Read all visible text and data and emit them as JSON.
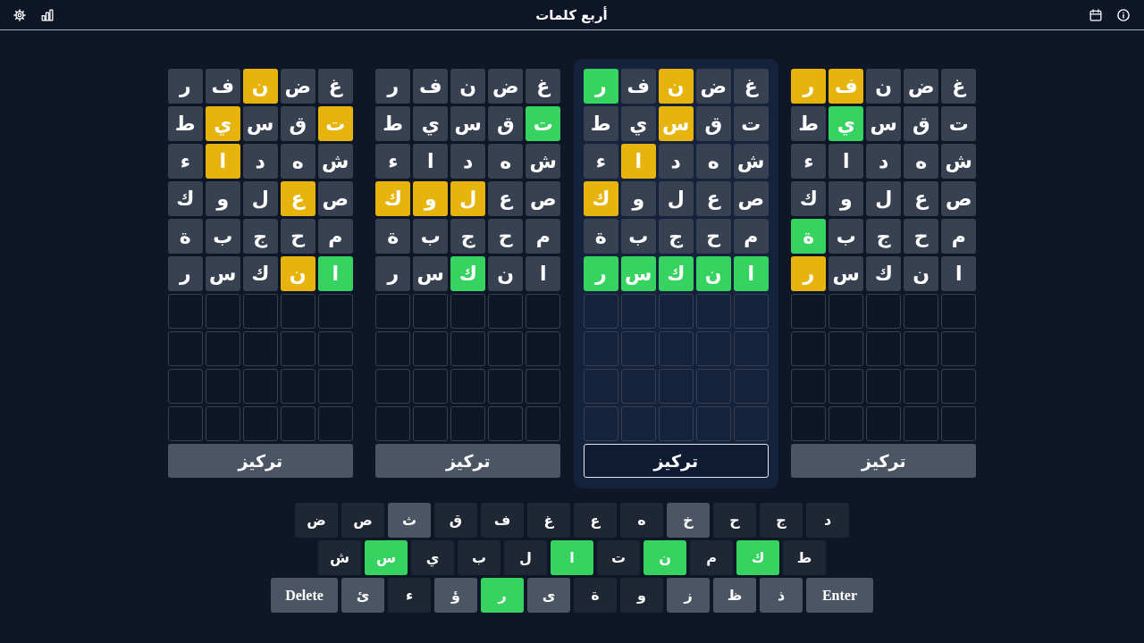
{
  "header": {
    "title": "أربع كلمات"
  },
  "boards": [
    {
      "focused": false,
      "button": "تركيز",
      "rows": [
        {
          "kind": "guess",
          "tiles": [
            {
              "letter": "غ",
              "color": "#374151"
            },
            {
              "letter": "ض",
              "color": "#374151"
            },
            {
              "letter": "ن",
              "color": "#374151"
            },
            {
              "letter": "ف",
              "color": "#e6b40c"
            },
            {
              "letter": "ر",
              "color": "#e6b40c"
            }
          ]
        },
        {
          "kind": "guess",
          "tiles": [
            {
              "letter": "ت",
              "color": "#374151"
            },
            {
              "letter": "ق",
              "color": "#374151"
            },
            {
              "letter": "س",
              "color": "#374151"
            },
            {
              "letter": "ي",
              "color": "#36d361"
            },
            {
              "letter": "ط",
              "color": "#374151"
            }
          ]
        },
        {
          "kind": "guess",
          "tiles": [
            {
              "letter": "ش",
              "color": "#374151"
            },
            {
              "letter": "ه",
              "color": "#374151"
            },
            {
              "letter": "د",
              "color": "#374151"
            },
            {
              "letter": "ا",
              "color": "#374151"
            },
            {
              "letter": "ء",
              "color": "#374151"
            }
          ]
        },
        {
          "kind": "guess",
          "tiles": [
            {
              "letter": "ص",
              "color": "#374151"
            },
            {
              "letter": "ع",
              "color": "#374151"
            },
            {
              "letter": "ل",
              "color": "#374151"
            },
            {
              "letter": "و",
              "color": "#374151"
            },
            {
              "letter": "ك",
              "color": "#374151"
            }
          ]
        },
        {
          "kind": "guess",
          "tiles": [
            {
              "letter": "م",
              "color": "#374151"
            },
            {
              "letter": "ح",
              "color": "#374151"
            },
            {
              "letter": "ج",
              "color": "#374151"
            },
            {
              "letter": "ب",
              "color": "#374151"
            },
            {
              "letter": "ة",
              "color": "#36d361"
            }
          ]
        },
        {
          "kind": "guess",
          "tiles": [
            {
              "letter": "ا",
              "color": "#374151"
            },
            {
              "letter": "ن",
              "color": "#374151"
            },
            {
              "letter": "ك",
              "color": "#374151"
            },
            {
              "letter": "س",
              "color": "#374151"
            },
            {
              "letter": "ر",
              "color": "#e6b40c"
            }
          ]
        },
        {
          "kind": "empty"
        },
        {
          "kind": "empty"
        },
        {
          "kind": "empty"
        },
        {
          "kind": "empty"
        }
      ]
    },
    {
      "focused": true,
      "button": "تركيز",
      "rows": [
        {
          "kind": "guess",
          "tiles": [
            {
              "letter": "غ",
              "color": "#374151"
            },
            {
              "letter": "ض",
              "color": "#374151"
            },
            {
              "letter": "ن",
              "color": "#e6b40c"
            },
            {
              "letter": "ف",
              "color": "#374151"
            },
            {
              "letter": "ر",
              "color": "#36d361"
            }
          ]
        },
        {
          "kind": "guess",
          "tiles": [
            {
              "letter": "ت",
              "color": "#374151"
            },
            {
              "letter": "ق",
              "color": "#374151"
            },
            {
              "letter": "س",
              "color": "#e6b40c"
            },
            {
              "letter": "ي",
              "color": "#374151"
            },
            {
              "letter": "ط",
              "color": "#374151"
            }
          ]
        },
        {
          "kind": "guess",
          "tiles": [
            {
              "letter": "ش",
              "color": "#374151"
            },
            {
              "letter": "ه",
              "color": "#374151"
            },
            {
              "letter": "د",
              "color": "#374151"
            },
            {
              "letter": "ا",
              "color": "#e6b40c"
            },
            {
              "letter": "ء",
              "color": "#374151"
            }
          ]
        },
        {
          "kind": "guess",
          "tiles": [
            {
              "letter": "ص",
              "color": "#374151"
            },
            {
              "letter": "ع",
              "color": "#374151"
            },
            {
              "letter": "ل",
              "color": "#374151"
            },
            {
              "letter": "و",
              "color": "#374151"
            },
            {
              "letter": "ك",
              "color": "#e6b40c"
            }
          ]
        },
        {
          "kind": "guess",
          "tiles": [
            {
              "letter": "م",
              "color": "#374151"
            },
            {
              "letter": "ح",
              "color": "#374151"
            },
            {
              "letter": "ج",
              "color": "#374151"
            },
            {
              "letter": "ب",
              "color": "#374151"
            },
            {
              "letter": "ة",
              "color": "#374151"
            }
          ]
        },
        {
          "kind": "guess",
          "tiles": [
            {
              "letter": "ا",
              "color": "#36d361"
            },
            {
              "letter": "ن",
              "color": "#36d361"
            },
            {
              "letter": "ك",
              "color": "#36d361"
            },
            {
              "letter": "س",
              "color": "#36d361"
            },
            {
              "letter": "ر",
              "color": "#36d361"
            }
          ]
        },
        {
          "kind": "empty"
        },
        {
          "kind": "empty"
        },
        {
          "kind": "empty"
        },
        {
          "kind": "empty"
        }
      ]
    },
    {
      "focused": false,
      "button": "تركيز",
      "rows": [
        {
          "kind": "guess",
          "tiles": [
            {
              "letter": "غ",
              "color": "#374151"
            },
            {
              "letter": "ض",
              "color": "#374151"
            },
            {
              "letter": "ن",
              "color": "#374151"
            },
            {
              "letter": "ف",
              "color": "#374151"
            },
            {
              "letter": "ر",
              "color": "#374151"
            }
          ]
        },
        {
          "kind": "guess",
          "tiles": [
            {
              "letter": "ت",
              "color": "#36d361"
            },
            {
              "letter": "ق",
              "color": "#374151"
            },
            {
              "letter": "س",
              "color": "#374151"
            },
            {
              "letter": "ي",
              "color": "#374151"
            },
            {
              "letter": "ط",
              "color": "#374151"
            }
          ]
        },
        {
          "kind": "guess",
          "tiles": [
            {
              "letter": "ش",
              "color": "#374151"
            },
            {
              "letter": "ه",
              "color": "#374151"
            },
            {
              "letter": "د",
              "color": "#374151"
            },
            {
              "letter": "ا",
              "color": "#374151"
            },
            {
              "letter": "ء",
              "color": "#374151"
            }
          ]
        },
        {
          "kind": "guess",
          "tiles": [
            {
              "letter": "ص",
              "color": "#374151"
            },
            {
              "letter": "ع",
              "color": "#374151"
            },
            {
              "letter": "ل",
              "color": "#e6b40c"
            },
            {
              "letter": "و",
              "color": "#e6b40c"
            },
            {
              "letter": "ك",
              "color": "#e6b40c"
            }
          ]
        },
        {
          "kind": "guess",
          "tiles": [
            {
              "letter": "م",
              "color": "#374151"
            },
            {
              "letter": "ح",
              "color": "#374151"
            },
            {
              "letter": "ج",
              "color": "#374151"
            },
            {
              "letter": "ب",
              "color": "#374151"
            },
            {
              "letter": "ة",
              "color": "#374151"
            }
          ]
        },
        {
          "kind": "guess",
          "tiles": [
            {
              "letter": "ا",
              "color": "#374151"
            },
            {
              "letter": "ن",
              "color": "#374151"
            },
            {
              "letter": "ك",
              "color": "#36d361"
            },
            {
              "letter": "س",
              "color": "#374151"
            },
            {
              "letter": "ر",
              "color": "#374151"
            }
          ]
        },
        {
          "kind": "empty"
        },
        {
          "kind": "empty"
        },
        {
          "kind": "empty"
        },
        {
          "kind": "empty"
        }
      ]
    },
    {
      "focused": false,
      "button": "تركيز",
      "rows": [
        {
          "kind": "guess",
          "tiles": [
            {
              "letter": "غ",
              "color": "#374151"
            },
            {
              "letter": "ض",
              "color": "#374151"
            },
            {
              "letter": "ن",
              "color": "#e6b40c"
            },
            {
              "letter": "ف",
              "color": "#374151"
            },
            {
              "letter": "ر",
              "color": "#374151"
            }
          ]
        },
        {
          "kind": "guess",
          "tiles": [
            {
              "letter": "ت",
              "color": "#e6b40c"
            },
            {
              "letter": "ق",
              "color": "#374151"
            },
            {
              "letter": "س",
              "color": "#374151"
            },
            {
              "letter": "ي",
              "color": "#e6b40c"
            },
            {
              "letter": "ط",
              "color": "#374151"
            }
          ]
        },
        {
          "kind": "guess",
          "tiles": [
            {
              "letter": "ش",
              "color": "#374151"
            },
            {
              "letter": "ه",
              "color": "#374151"
            },
            {
              "letter": "د",
              "color": "#374151"
            },
            {
              "letter": "ا",
              "color": "#e6b40c"
            },
            {
              "letter": "ء",
              "color": "#374151"
            }
          ]
        },
        {
          "kind": "guess",
          "tiles": [
            {
              "letter": "ص",
              "color": "#374151"
            },
            {
              "letter": "ع",
              "color": "#e6b40c"
            },
            {
              "letter": "ل",
              "color": "#374151"
            },
            {
              "letter": "و",
              "color": "#374151"
            },
            {
              "letter": "ك",
              "color": "#374151"
            }
          ]
        },
        {
          "kind": "guess",
          "tiles": [
            {
              "letter": "م",
              "color": "#374151"
            },
            {
              "letter": "ح",
              "color": "#374151"
            },
            {
              "letter": "ج",
              "color": "#374151"
            },
            {
              "letter": "ب",
              "color": "#374151"
            },
            {
              "letter": "ة",
              "color": "#374151"
            }
          ]
        },
        {
          "kind": "guess",
          "tiles": [
            {
              "letter": "ا",
              "color": "#36d361"
            },
            {
              "letter": "ن",
              "color": "#e6b40c"
            },
            {
              "letter": "ك",
              "color": "#374151"
            },
            {
              "letter": "س",
              "color": "#374151"
            },
            {
              "letter": "ر",
              "color": "#374151"
            }
          ]
        },
        {
          "kind": "empty"
        },
        {
          "kind": "empty"
        },
        {
          "kind": "empty"
        },
        {
          "kind": "empty"
        }
      ]
    }
  ],
  "keyboard": {
    "rows": [
      {
        "keys": [
          {
            "kind": "letter",
            "label": "د",
            "color": "#1f2735"
          },
          {
            "kind": "letter",
            "label": "ج",
            "color": "#1f2735"
          },
          {
            "kind": "letter",
            "label": "ح",
            "color": "#1f2735"
          },
          {
            "kind": "letter",
            "label": "خ",
            "color": "#4b5563"
          },
          {
            "kind": "letter",
            "label": "ه",
            "color": "#1f2735"
          },
          {
            "kind": "letter",
            "label": "ع",
            "color": "#1f2735"
          },
          {
            "kind": "letter",
            "label": "غ",
            "color": "#1f2735"
          },
          {
            "kind": "letter",
            "label": "ف",
            "color": "#1f2735"
          },
          {
            "kind": "letter",
            "label": "ق",
            "color": "#1f2735"
          },
          {
            "kind": "letter",
            "label": "ث",
            "color": "#4b5563"
          },
          {
            "kind": "letter",
            "label": "ص",
            "color": "#1f2735"
          },
          {
            "kind": "letter",
            "label": "ض",
            "color": "#1f2735"
          }
        ]
      },
      {
        "keys": [
          {
            "kind": "letter",
            "label": "ط",
            "color": "#1f2735"
          },
          {
            "kind": "letter",
            "label": "ك",
            "color": "#36d361"
          },
          {
            "kind": "letter",
            "label": "م",
            "color": "#1f2735"
          },
          {
            "kind": "letter",
            "label": "ن",
            "color": "#36d361"
          },
          {
            "kind": "letter",
            "label": "ت",
            "color": "#1f2735"
          },
          {
            "kind": "letter",
            "label": "ا",
            "color": "#36d361"
          },
          {
            "kind": "letter",
            "label": "ل",
            "color": "#1f2735"
          },
          {
            "kind": "letter",
            "label": "ب",
            "color": "#1f2735"
          },
          {
            "kind": "letter",
            "label": "ي",
            "color": "#1f2735"
          },
          {
            "kind": "letter",
            "label": "س",
            "color": "#36d361"
          },
          {
            "kind": "letter",
            "label": "ش",
            "color": "#1f2735"
          }
        ]
      },
      {
        "keys": [
          {
            "kind": "enter",
            "label": "Enter"
          },
          {
            "kind": "letter",
            "label": "ذ",
            "color": "#4b5563"
          },
          {
            "kind": "letter",
            "label": "ظ",
            "color": "#4b5563"
          },
          {
            "kind": "letter",
            "label": "ز",
            "color": "#4b5563"
          },
          {
            "kind": "letter",
            "label": "و",
            "color": "#1f2735"
          },
          {
            "kind": "letter",
            "label": "ة",
            "color": "#1f2735"
          },
          {
            "kind": "letter",
            "label": "ى",
            "color": "#4b5563"
          },
          {
            "kind": "letter",
            "label": "ر",
            "color": "#36d361"
          },
          {
            "kind": "letter",
            "label": "ؤ",
            "color": "#4b5563"
          },
          {
            "kind": "letter",
            "label": "ء",
            "color": "#1f2735"
          },
          {
            "kind": "letter",
            "label": "ئ",
            "color": "#4b5563"
          },
          {
            "kind": "delete",
            "label": "Delete"
          }
        ]
      }
    ]
  }
}
